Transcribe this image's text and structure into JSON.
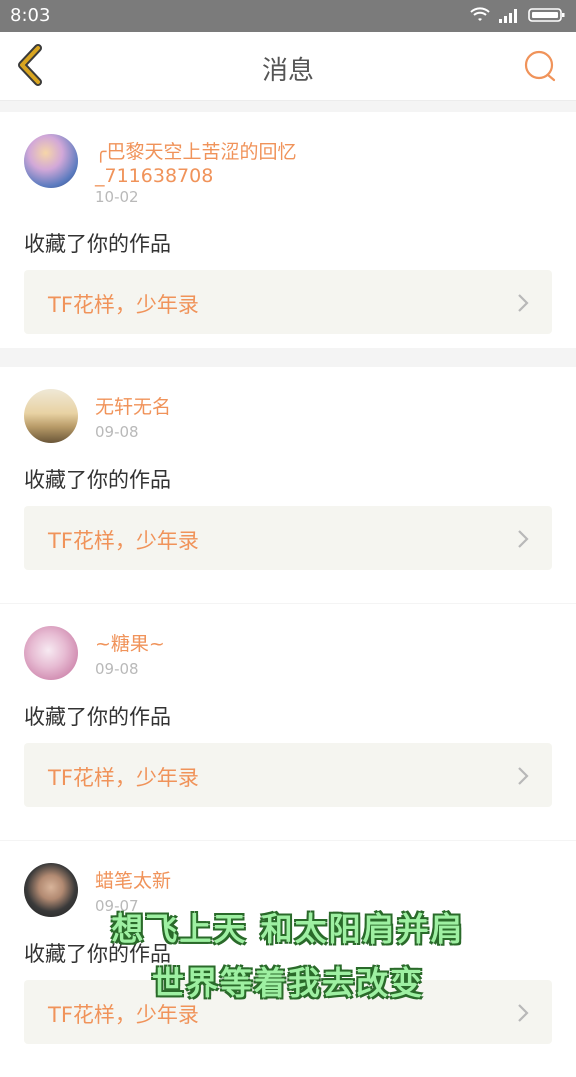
{
  "status": {
    "time": "8:03"
  },
  "header": {
    "title": "消息"
  },
  "messages": [
    {
      "user": "╭巴黎天空上苦涩的回忆_711638708",
      "date": "10-02",
      "action": "收藏了你的作品",
      "work": "TF花样，少年录"
    },
    {
      "user": "无轩无名",
      "date": "09-08",
      "action": "收藏了你的作品",
      "work": "TF花样，少年录"
    },
    {
      "user": "~糖果~",
      "date": "09-08",
      "action": "收藏了你的作品",
      "work": "TF花样，少年录"
    },
    {
      "user": "蜡笔太新",
      "date": "09-07",
      "action": "收藏了你的作品",
      "work": "TF花样，少年录"
    }
  ],
  "overlay": {
    "line1": "想飞上天 和太阳肩并肩",
    "line2": "世界等着我去改变"
  },
  "colors": {
    "accent": "#f0935a",
    "status_bar": "#7b7b7b",
    "back_icon": "#d9a520"
  }
}
